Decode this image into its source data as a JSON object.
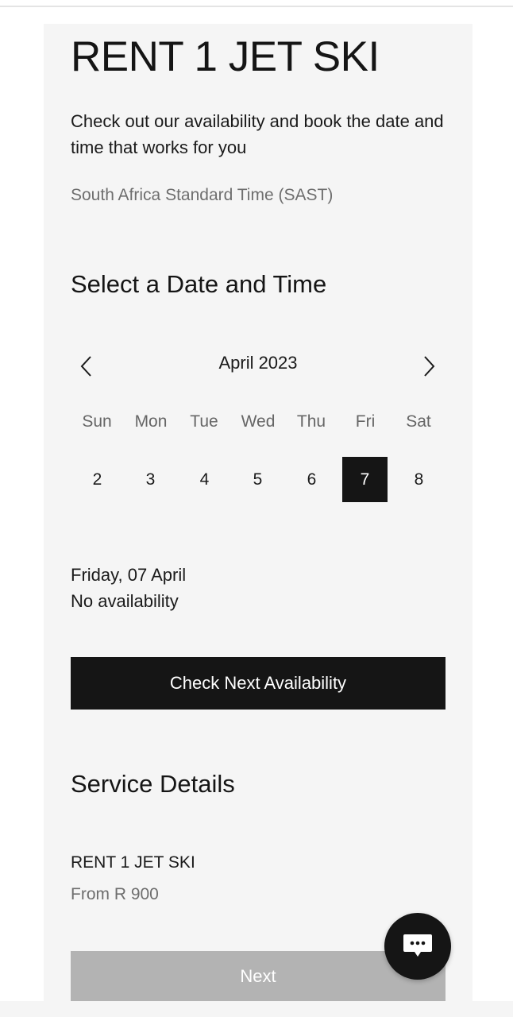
{
  "header": {
    "title": "RENT 1 JET SKI",
    "subtitle": "Check out our availability and book the date and time that works for you",
    "timezone": "South Africa Standard Time (SAST)"
  },
  "calendar": {
    "section_title": "Select a Date and Time",
    "month_label": "April 2023",
    "weekdays": [
      "Sun",
      "Mon",
      "Tue",
      "Wed",
      "Thu",
      "Fri",
      "Sat"
    ],
    "days": [
      "2",
      "3",
      "4",
      "5",
      "6",
      "7",
      "8"
    ],
    "selected_day": "7",
    "prev_icon": "chevron-left-icon",
    "next_icon": "chevron-right-icon"
  },
  "selection": {
    "date_label": "Friday, 07 April",
    "availability_label": "No availability",
    "check_button_label": "Check Next Availability"
  },
  "service": {
    "section_title": "Service Details",
    "name": "RENT 1 JET SKI",
    "price": "From R 900"
  },
  "footer": {
    "next_button_label": "Next",
    "chat_icon": "chat-bubble-icon"
  },
  "colors": {
    "panel_background": "#f5f5f5",
    "primary_button": "#151515",
    "disabled_button": "#b3b3b3",
    "muted_text": "#6e6e6e"
  }
}
